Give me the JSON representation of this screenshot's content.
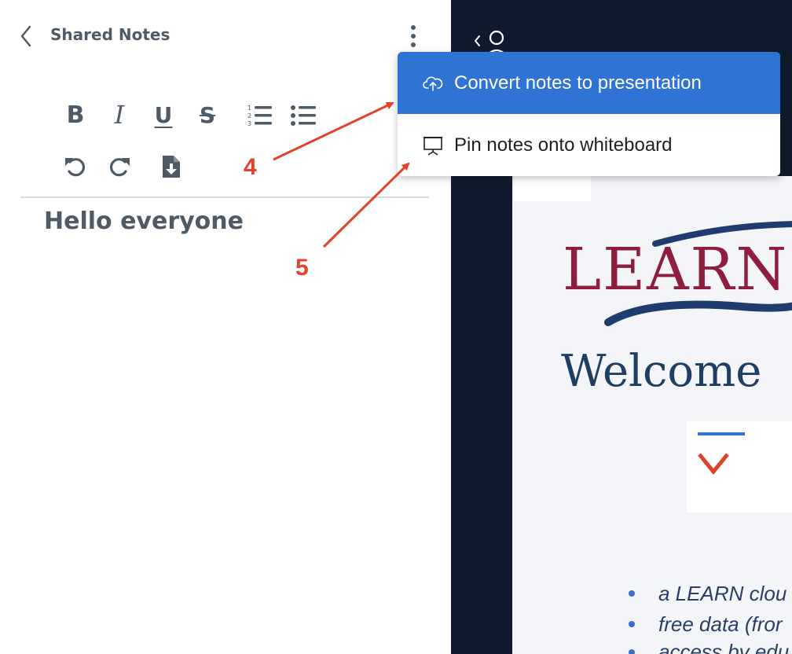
{
  "panel": {
    "title": "Shared Notes",
    "note_text": "Hello everyone"
  },
  "toolbar": {
    "tools": [
      {
        "name": "bold",
        "icon": "bold-icon",
        "glyph": "B"
      },
      {
        "name": "italic",
        "icon": "italic-icon",
        "glyph": "I"
      },
      {
        "name": "underline",
        "icon": "underline-icon",
        "glyph": "U"
      },
      {
        "name": "strikethrough",
        "icon": "strikethrough-icon",
        "glyph": "S"
      },
      {
        "name": "ordered-list",
        "icon": "ordered-list-icon"
      },
      {
        "name": "bullet-list",
        "icon": "bullet-list-icon"
      },
      {
        "name": "undo",
        "icon": "undo-icon"
      },
      {
        "name": "redo",
        "icon": "redo-icon"
      },
      {
        "name": "export",
        "icon": "file-download-icon"
      }
    ]
  },
  "menu": {
    "items": [
      {
        "label": "Convert notes to presentation",
        "icon": "cloud-upload-icon",
        "highlighted": true
      },
      {
        "label": "Pin notes onto whiteboard",
        "icon": "presentation-board-icon",
        "highlighted": false
      }
    ]
  },
  "presentation": {
    "logo_text": "LEARN",
    "welcome_text": "Welcome",
    "bullets": [
      "a LEARN clou",
      "free data (fror",
      "access by edu"
    ]
  },
  "annotations": {
    "labels": [
      "4",
      "5"
    ],
    "color": "#e2412a"
  },
  "colors": {
    "accent": "#2f73d4",
    "text": "#4e5a66",
    "dark_bg": "#0f1b2d"
  }
}
